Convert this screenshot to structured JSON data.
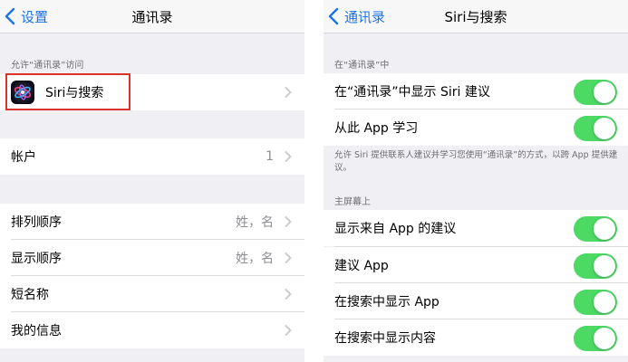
{
  "left": {
    "nav": {
      "back_label": "设置",
      "title": "通讯录"
    },
    "section_header": "允许“通讯录”访问",
    "siri_row": {
      "label": "Siri与搜索"
    },
    "accounts_row": {
      "label": "帐户",
      "value": "1"
    },
    "sort_order_row": {
      "label": "排列顺序",
      "value": "姓，名"
    },
    "display_order_row": {
      "label": "显示顺序",
      "value": "姓，名"
    },
    "short_name_row": {
      "label": "短名称"
    },
    "my_info_row": {
      "label": "我的信息"
    }
  },
  "right": {
    "nav": {
      "back_label": "通讯录",
      "title": "Siri与搜索"
    },
    "section1_header": "在“通讯录”中",
    "show_siri_suggestions": {
      "label": "在“通讯录”中显示 Siri 建议",
      "on": true
    },
    "learn_from_app": {
      "label": "从此 App 学习",
      "on": true
    },
    "footer_note": "允许 Siri 提供联系人建议并学习您使用“通讯录”的方式，以跨 App 提供建议。",
    "section2_header": "主屏幕上",
    "show_suggestions_from_app": {
      "label": "显示来自 App 的建议",
      "on": true
    },
    "suggest_app": {
      "label": "建议 App",
      "on": true
    },
    "show_app_in_search": {
      "label": "在搜索中显示 App",
      "on": true
    },
    "show_content_in_search": {
      "label": "在搜索中显示内容",
      "on": true
    }
  },
  "colors": {
    "accent": "#1a73e8",
    "toggle_on": "#4cd964",
    "highlight": "#d9322b",
    "background": "#efeff4"
  }
}
